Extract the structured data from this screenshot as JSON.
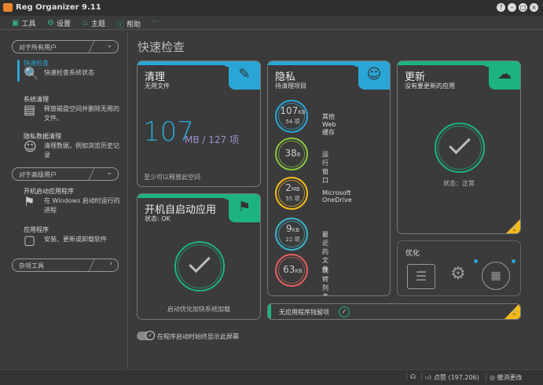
{
  "app": {
    "title": "Reg Organizer 9.11"
  },
  "window_controls": [
    "?",
    "–",
    "□",
    "×"
  ],
  "menu": [
    {
      "label": "工具",
      "icon": "toolbox-icon"
    },
    {
      "label": "设置",
      "icon": "gear-icon"
    },
    {
      "label": "主题",
      "icon": "bulb-icon"
    },
    {
      "label": "帮助",
      "icon": "help-icon"
    },
    {
      "label": "···",
      "icon": "more-icon"
    }
  ],
  "sidebar": {
    "group_all": "对于所有用户",
    "quick_check": {
      "title": "快速检查",
      "desc": "快速检查系统状态"
    },
    "system_clean": {
      "title": "系统清理",
      "desc": "释放磁盘空间并删除无用的文件。"
    },
    "privacy_clean": {
      "title": "隐私数据清理",
      "desc": "清理数据，例如浏览历史记录"
    },
    "group_advanced": "对于高级用户",
    "startup": {
      "title": "开机启动应用程序",
      "desc": "在 Windows 启动时运行的进程"
    },
    "apps": {
      "title": "应用程序",
      "desc": "安装、更新或卸载软件"
    },
    "group_misc": "杂项工具"
  },
  "main": {
    "title": "快速检查",
    "clean": {
      "title": "清理",
      "subtitle": "无用文件",
      "size": "107",
      "unit": "MB / 127 项",
      "note": "至少可以释放此空间"
    },
    "startup": {
      "title": "开机自启动应用",
      "subtitle": "状态: OK",
      "note": "启动优化加快系统加载"
    },
    "privacy": {
      "title": "隐私",
      "subtitle": "待清理项目",
      "items": [
        {
          "value": "107",
          "unit": "KB",
          "count": "54 项",
          "label": "其他 Web 缓存",
          "color": "#2aa6d6"
        },
        {
          "value": "38",
          "unit": "B",
          "count": "",
          "label": "运行窗口",
          "color": "#8cc63f"
        },
        {
          "value": "2",
          "unit": "MB",
          "count": "55 项",
          "label": "Microsoft OneDrive",
          "color": "#f3bb1b"
        },
        {
          "value": "9",
          "unit": "KB",
          "count": "22 项",
          "label": "最近的文件",
          "color": "#3ab8cc"
        },
        {
          "value": "63",
          "unit": "KB",
          "count": "",
          "label": "跳转列表",
          "color": "#e06060"
        }
      ]
    },
    "update": {
      "title": "更新",
      "subtitle": "没有要更新的应用",
      "status": "状态：正常"
    },
    "optimize": {
      "title": "优化"
    },
    "leftovers": {
      "label": "无应用程序残留项"
    },
    "toggle_label": "在程序启动时始终显示此屏幕"
  },
  "status": {
    "like": "点赞 (197,206)",
    "undo": "撤消更改"
  },
  "colors": {
    "blue": "#2aa6d6",
    "green": "#1db37f",
    "yellow": "#f3bb1b"
  }
}
